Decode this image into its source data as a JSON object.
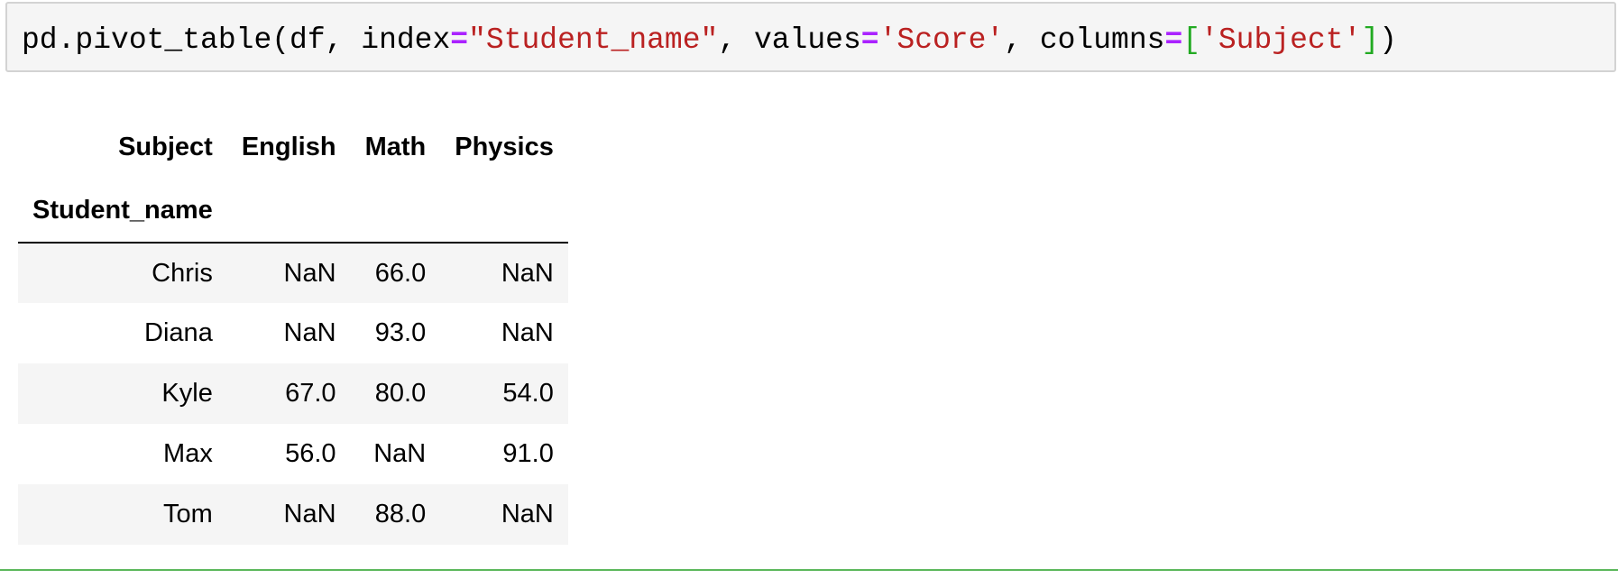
{
  "code_cell": {
    "tokens": [
      {
        "text": "pd.pivot_table(df, index",
        "kind": "plain"
      },
      {
        "text": "=",
        "kind": "op"
      },
      {
        "text": "\"Student_name\"",
        "kind": "str"
      },
      {
        "text": ", values",
        "kind": "plain"
      },
      {
        "text": "=",
        "kind": "op"
      },
      {
        "text": "'Score'",
        "kind": "str"
      },
      {
        "text": ", columns",
        "kind": "plain"
      },
      {
        "text": "=",
        "kind": "op"
      },
      {
        "text": "[",
        "kind": "brk"
      },
      {
        "text": "'Subject'",
        "kind": "str"
      },
      {
        "text": "]",
        "kind": "brk"
      },
      {
        "text": ")",
        "kind": "plain"
      }
    ],
    "colors": {
      "string": "#ba2121",
      "operator": "#aa22ff",
      "bracket": "#22aa22"
    }
  },
  "output": {
    "columns_name": "Subject",
    "index_name": "Student_name",
    "columns": [
      "English",
      "Math",
      "Physics"
    ],
    "rows": [
      {
        "index": "Chris",
        "values": [
          "NaN",
          "66.0",
          "NaN"
        ]
      },
      {
        "index": "Diana",
        "values": [
          "NaN",
          "93.0",
          "NaN"
        ]
      },
      {
        "index": "Kyle",
        "values": [
          "67.0",
          "80.0",
          "54.0"
        ]
      },
      {
        "index": "Max",
        "values": [
          "56.0",
          "NaN",
          "91.0"
        ]
      },
      {
        "index": "Tom",
        "values": [
          "NaN",
          "88.0",
          "NaN"
        ]
      }
    ]
  }
}
